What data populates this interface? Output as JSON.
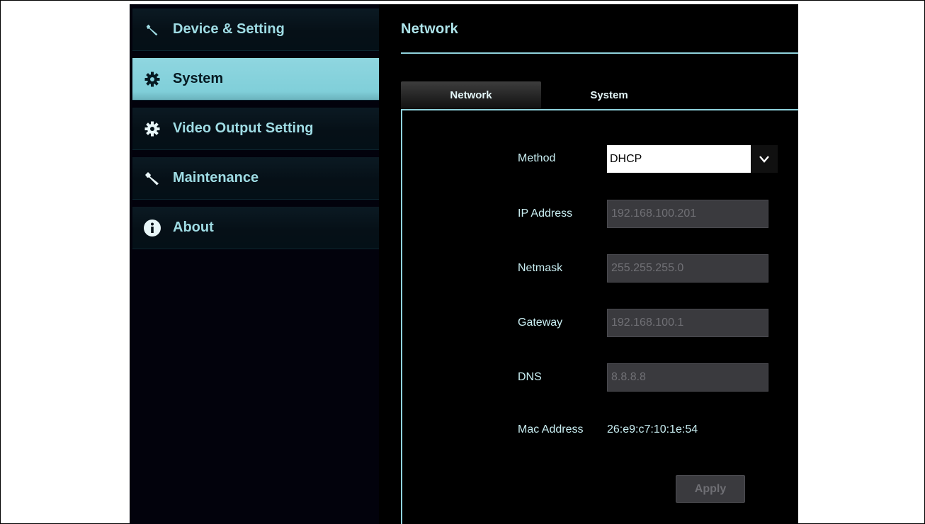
{
  "sidebar": {
    "items": [
      {
        "label": "Device & Setting",
        "icon": "wrench-icon"
      },
      {
        "label": "System",
        "icon": "gear-icon",
        "active": true
      },
      {
        "label": "Video Output Setting",
        "icon": "gear-icon"
      },
      {
        "label": "Maintenance",
        "icon": "wrench-icon"
      },
      {
        "label": "About",
        "icon": "info-icon"
      }
    ]
  },
  "main": {
    "title": "Network",
    "tabs": [
      {
        "label": "Network",
        "active": true
      },
      {
        "label": "System",
        "active": false
      }
    ],
    "form": {
      "method_label": "Method",
      "method_value": "DHCP",
      "ip_label": "IP Address",
      "ip_value": "192.168.100.201",
      "netmask_label": "Netmask",
      "netmask_value": "255.255.255.0",
      "gateway_label": "Gateway",
      "gateway_value": "192.168.100.1",
      "dns_label": "DNS",
      "dns_value": "8.8.8.8",
      "mac_label": "Mac Address",
      "mac_value": "26:e9:c7:10:1e:54",
      "apply_label": "Apply"
    }
  },
  "colors": {
    "accent": "#8fd6e0",
    "text": "#c9eef2",
    "background": "#000000"
  }
}
